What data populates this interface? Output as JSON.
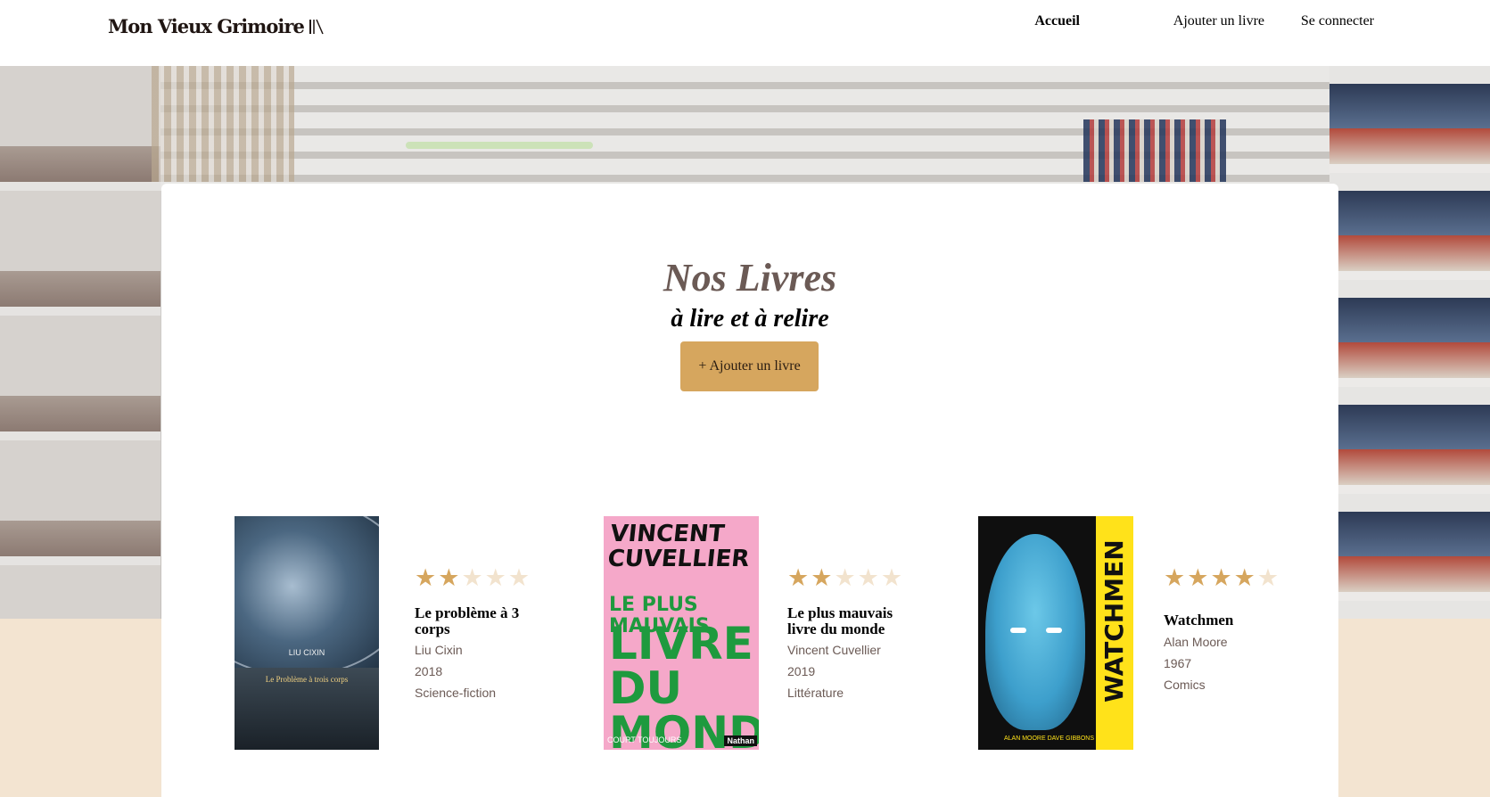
{
  "header": {
    "logo_text": "Mon Vieux Grimoire",
    "nav": [
      {
        "label": "Accueil",
        "active": true
      },
      {
        "label": "Ajouter un livre",
        "active": false
      },
      {
        "label": "Se connecter",
        "active": false
      }
    ]
  },
  "main": {
    "title": "Nos Livres",
    "subtitle": "à lire et à relire",
    "add_button_label": "+ Ajouter un livre"
  },
  "books": [
    {
      "title": "Le problème à 3 corps",
      "author": "Liu Cixin",
      "year": "2018",
      "genre": "Science-fiction",
      "rating": 2,
      "max_rating": 5,
      "cover": {
        "author": "LIU CIXIN",
        "title": "Le Problème à trois corps"
      }
    },
    {
      "title": "Le plus mauvais livre du monde",
      "author": "Vincent Cuvellier",
      "year": "2019",
      "genre": "Littérature",
      "rating": 2,
      "max_rating": 5,
      "cover": {
        "line1": "VINCENT CUVELLIER",
        "line2": "LE PLUS MAUVAIS",
        "line3": "LIVRE DU MONDE",
        "series": "COURT TOUJOURS",
        "publisher": "Nathan"
      }
    },
    {
      "title": "Watchmen",
      "author": "Alan Moore",
      "year": "1967",
      "genre": "Comics",
      "rating": 4,
      "max_rating": 5,
      "cover": {
        "title": "WATCHMEN",
        "authors": "ALAN MOORE DAVE GIBBONS"
      }
    }
  ],
  "colors": {
    "accent": "#d6a65e",
    "star_on": "#d6a65e",
    "star_off": "#f2e3ce",
    "title_color": "#6b5a55",
    "band": "#f3e4d1"
  },
  "icons": {
    "logo": "books-icon",
    "star": "star-icon"
  }
}
